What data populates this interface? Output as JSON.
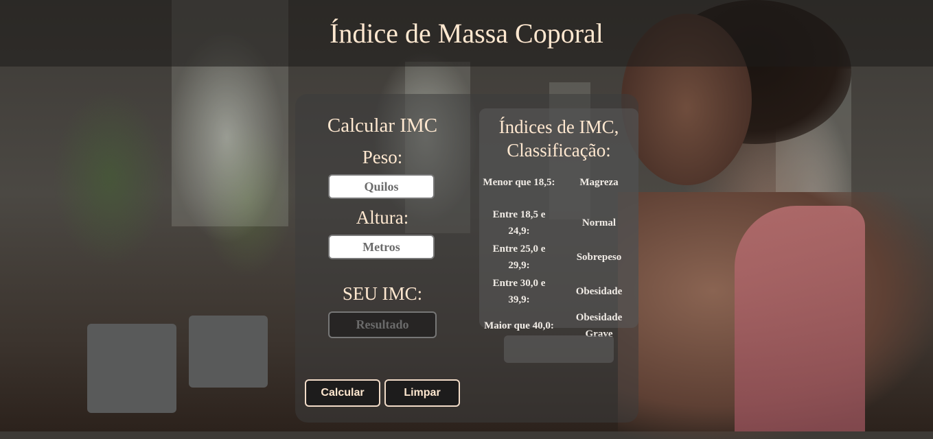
{
  "header": {
    "title": "Índice de Massa Coporal"
  },
  "calculator": {
    "title": "Calcular IMC",
    "weight_label": "Peso:",
    "weight_placeholder": "Quilos",
    "height_label": "Altura:",
    "height_placeholder": "Metros",
    "result_label": "SEU IMC:",
    "result_value": "Resultado",
    "calc_button": "Calcular",
    "clear_button": "Limpar"
  },
  "index_table": {
    "title_line1": "Índices de IMC,",
    "title_line2": "Classificação:",
    "rows": [
      {
        "range_line1": "Menor que 18,5:",
        "range_line2": "",
        "class_line1": "Magreza",
        "class_line2": ""
      },
      {
        "range_line1": "Entre 18,5 e",
        "range_line2": "24,9:",
        "class_line1": "Normal",
        "class_line2": ""
      },
      {
        "range_line1": "Entre 25,0 e",
        "range_line2": "29,9:",
        "class_line1": "Sobrepeso",
        "class_line2": ""
      },
      {
        "range_line1": "Entre 30,0 e",
        "range_line2": "39,9:",
        "class_line1": "Obesidade",
        "class_line2": ""
      },
      {
        "range_line1": "Maior que 40,0:",
        "range_line2": "",
        "class_line1": "Obesidade",
        "class_line2": "Grave"
      }
    ]
  },
  "message": {
    "text": ""
  },
  "colors": {
    "accent_text": "#ffe8d0",
    "button_border": "#f2dcc8"
  }
}
